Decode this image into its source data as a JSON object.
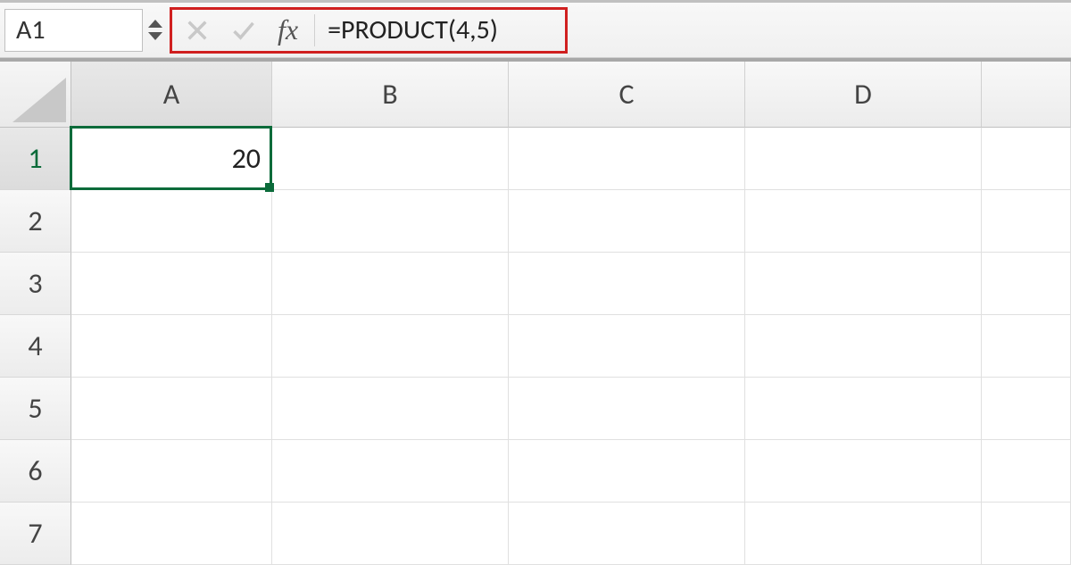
{
  "formula_bar": {
    "name_box": "A1",
    "fx_label": "fx",
    "formula": "=PRODUCT(4,5)"
  },
  "columns": [
    "A",
    "B",
    "C",
    "D",
    ""
  ],
  "rows": [
    "1",
    "2",
    "3",
    "4",
    "5",
    "6",
    "7"
  ],
  "active_column_index": 0,
  "active_row_index": 0,
  "cells": {
    "A1": "20"
  },
  "colors": {
    "selection": "#0b6b3a",
    "highlight_border": "#d02020"
  }
}
